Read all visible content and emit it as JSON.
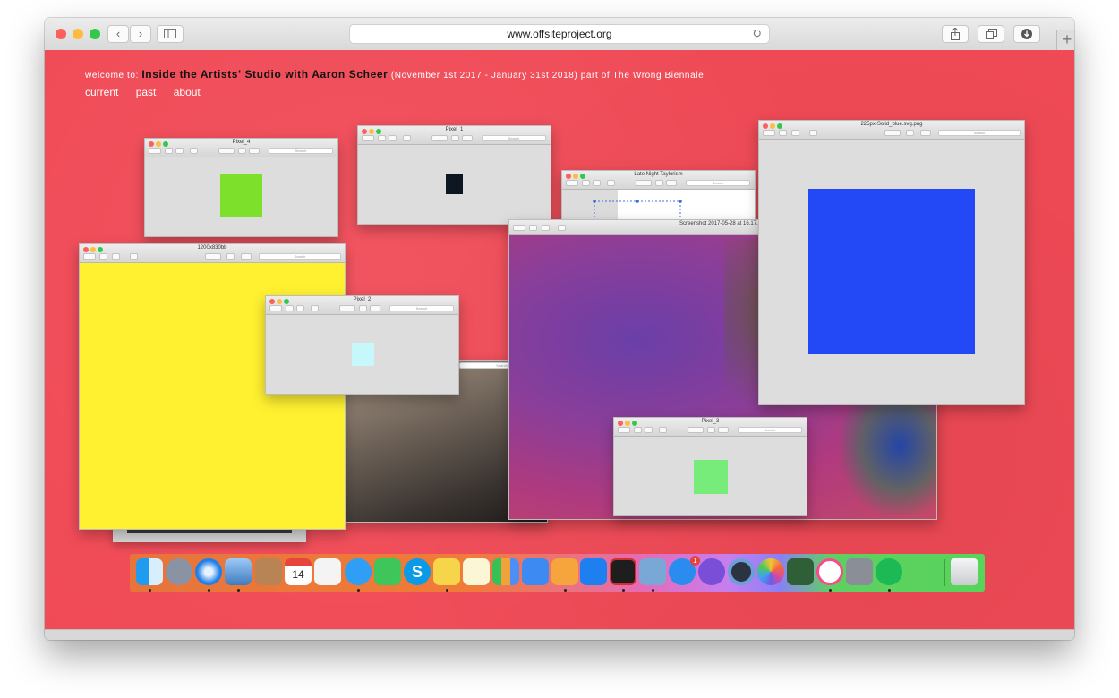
{
  "browser": {
    "url": "www.offsiteproject.org",
    "new_tab_label": "+"
  },
  "page": {
    "welcome_prefix": "welcome to:",
    "show_title": "Inside the Artists' Studio with Aaron Scheer",
    "show_suffix": "(November 1st 2017 - January 31st 2018) part of The Wrong Biennale",
    "nav": [
      "current",
      "past",
      "about"
    ]
  },
  "windows": {
    "search_placeholder": "Search",
    "pixel4": {
      "title": "Pixel_4"
    },
    "pixel1": {
      "title": "Pixel_1"
    },
    "latenight": {
      "title": "Late Night Taylorism"
    },
    "blue": {
      "title": "225px-Solid_blue.svg.png"
    },
    "yellow": {
      "title": "1200x830bb"
    },
    "screenshot": {
      "title": "Screenshot 2017-05-28 at 16.17."
    },
    "pixel2": {
      "title": "Pixel_2"
    },
    "pixel3": {
      "title": "Pixel_3"
    }
  },
  "colors": {
    "page_bg": "#f04a56",
    "green_square": "#7de02a",
    "dark_square": "#0c1722",
    "blue_square": "#2348f5",
    "yellow_fill": "#fff130",
    "cyan_square": "#c6f7fb",
    "light_green_square": "#77ec7a"
  },
  "dock": {
    "icons": [
      "finder-icon",
      "launchpad-icon",
      "safari-icon",
      "preview-icon",
      "contacts-icon",
      "calendar-icon",
      "textedit-icon",
      "messages-icon",
      "facetime-icon",
      "skype-icon",
      "stickies-icon",
      "notes-icon",
      "numbers-icon",
      "keynote-icon",
      "pages-icon",
      "dropbox-icon",
      "acrobat-icon",
      "image-capture-icon",
      "app-store-icon",
      "imovie-icon",
      "quicktime-icon",
      "photos-icon",
      "photo-booth-icon",
      "itunes-icon",
      "system-preferences-icon",
      "spotify-icon",
      "trash-icon"
    ],
    "calendar_day": "14",
    "app_store_badge": "1"
  }
}
